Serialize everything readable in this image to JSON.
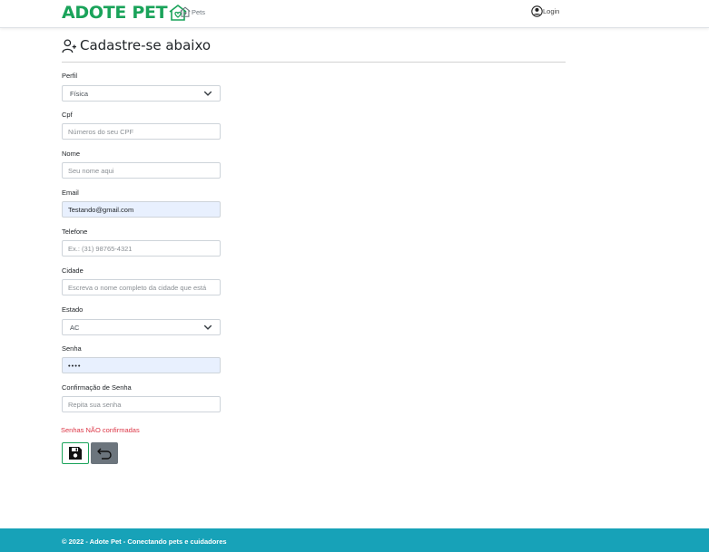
{
  "navbar": {
    "brand": "ADOTE PET",
    "pets_label": "Pets",
    "login_label": "Login"
  },
  "page": {
    "title": "Cadastre-se abaixo"
  },
  "form": {
    "perfil": {
      "label": "Perfil",
      "value": "Física"
    },
    "cpf": {
      "label": "Cpf",
      "placeholder": "Números do seu CPF",
      "value": ""
    },
    "nome": {
      "label": "Nome",
      "placeholder": "Seu nome aqui",
      "value": ""
    },
    "email": {
      "label": "Email",
      "value": "Testando@gmail.com"
    },
    "telefone": {
      "label": "Telefone",
      "placeholder": "Ex.: (31) 98765-4321",
      "value": ""
    },
    "cidade": {
      "label": "Cidade",
      "placeholder": "Escreva o nome completo da cidade que está",
      "value": ""
    },
    "estado": {
      "label": "Estado",
      "value": "AC"
    },
    "senha": {
      "label": "Senha",
      "value": "••••"
    },
    "confirmacao": {
      "label": "Confirmação de Senha",
      "placeholder": "Repita sua senha",
      "value": ""
    },
    "error": "Senhas NÃO confirmadas"
  },
  "icons": {
    "user_plus": "person-plus-icon",
    "save": "floppy-disk-icon",
    "back": "return-arrow-icon",
    "pets": "house-heart-icon",
    "login": "person-circle-icon"
  },
  "colors": {
    "brand": "#1aa35a",
    "footer": "#17a2b8",
    "error": "#dc3545",
    "autofill": "#e8f0fe",
    "secondary": "#6c757d"
  },
  "footer": {
    "text": "© 2022 - Adote Pet - Conectando pets e cuidadores"
  }
}
